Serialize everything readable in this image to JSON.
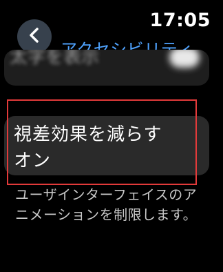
{
  "status_bar": {
    "time": "17:05"
  },
  "navigation": {
    "back_icon": "chevron-left-icon",
    "title": "アクセシビリティ"
  },
  "previous_row": {
    "label": "太字を表示",
    "toggle": "on"
  },
  "setting": {
    "title": "視差効果を減らす",
    "value": "オン"
  },
  "description": "ユーザインターフェイスのアニメーションを制限します。",
  "colors": {
    "background": "#000000",
    "accent": "#4fa3ff",
    "cell": "#2a2a2a",
    "highlight": "#e23a3a"
  }
}
